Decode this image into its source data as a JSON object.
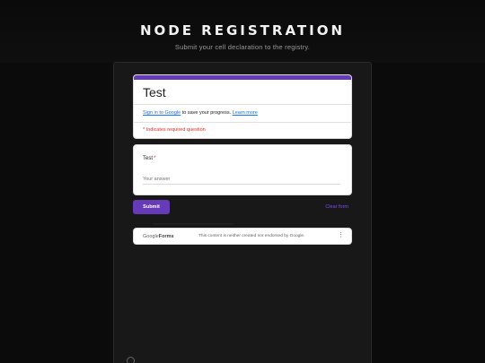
{
  "page": {
    "title": "NODE REGISTRATION",
    "subtitle": "Submit your cell declaration to the registry."
  },
  "form": {
    "title": "Test",
    "signin_link": "Sign in to Google",
    "signin_text": " to save your progress. ",
    "learn_more": "Learn more",
    "required_note": "* Indicates required question",
    "question": {
      "label": "Test",
      "required_mark": "*",
      "placeholder": "Your answer"
    },
    "submit_label": "Submit",
    "clear_label": "Clear form",
    "footer": {
      "logo_google": "Google",
      "logo_forms": "Forms",
      "disclaimer": "This content is neither created nor endorsed by Google."
    }
  },
  "colors": {
    "accent": "#673ab7",
    "required": "#d93025",
    "link": "#1a73e8",
    "background": "#0b0b0b"
  },
  "icons": {
    "kebab": "more-vert-icon",
    "help": "help-icon"
  }
}
